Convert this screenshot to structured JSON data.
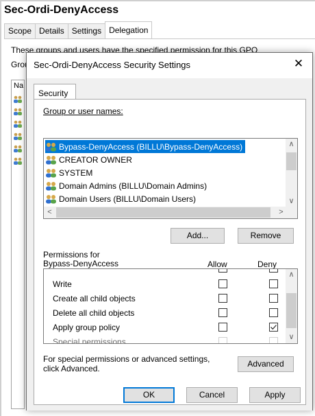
{
  "gpo": {
    "title": "Sec-Ordi-DenyAccess",
    "tabs": [
      "Scope",
      "Details",
      "Settings",
      "Delegation"
    ],
    "description": "These groups and users have the specified permission for this GPO",
    "groups_label_fragment": "Grou",
    "list_header_fragment": "Na"
  },
  "dialog": {
    "title": "Sec-Ordi-DenyAccess Security Settings",
    "close_glyph": "✕",
    "tab": "Security",
    "group_label": "Group or user names:",
    "users": [
      {
        "name": "Bypass-DenyAccess (BILLU\\Bypass-DenyAccess)",
        "selected": true
      },
      {
        "name": "CREATOR OWNER",
        "selected": false
      },
      {
        "name": "SYSTEM",
        "selected": false
      },
      {
        "name": "Domain Admins (BILLU\\Domain Admins)",
        "selected": false
      },
      {
        "name": "Domain Users (BILLU\\Domain Users)",
        "selected": false
      }
    ],
    "add_button": "Add...",
    "remove_button": "Remove",
    "permissions_for_line1": "Permissions for",
    "permissions_for_line2": "Bypass-DenyAccess",
    "allow_header": "Allow",
    "deny_header": "Deny",
    "permissions": [
      {
        "name": "Write",
        "allow": false,
        "deny": false,
        "dim": false
      },
      {
        "name": "Create all child objects",
        "allow": false,
        "deny": false,
        "dim": false
      },
      {
        "name": "Delete all child objects",
        "allow": false,
        "deny": false,
        "dim": false
      },
      {
        "name": "Apply group policy",
        "allow": false,
        "deny": true,
        "dim": false
      },
      {
        "name": "Special permissions",
        "allow": false,
        "deny": false,
        "dim": true
      }
    ],
    "advanced_text_line1": "For special permissions or advanced settings,",
    "advanced_text_line2": "click Advanced.",
    "advanced_button": "Advanced",
    "ok_button": "OK",
    "cancel_button": "Cancel",
    "apply_button": "Apply"
  }
}
